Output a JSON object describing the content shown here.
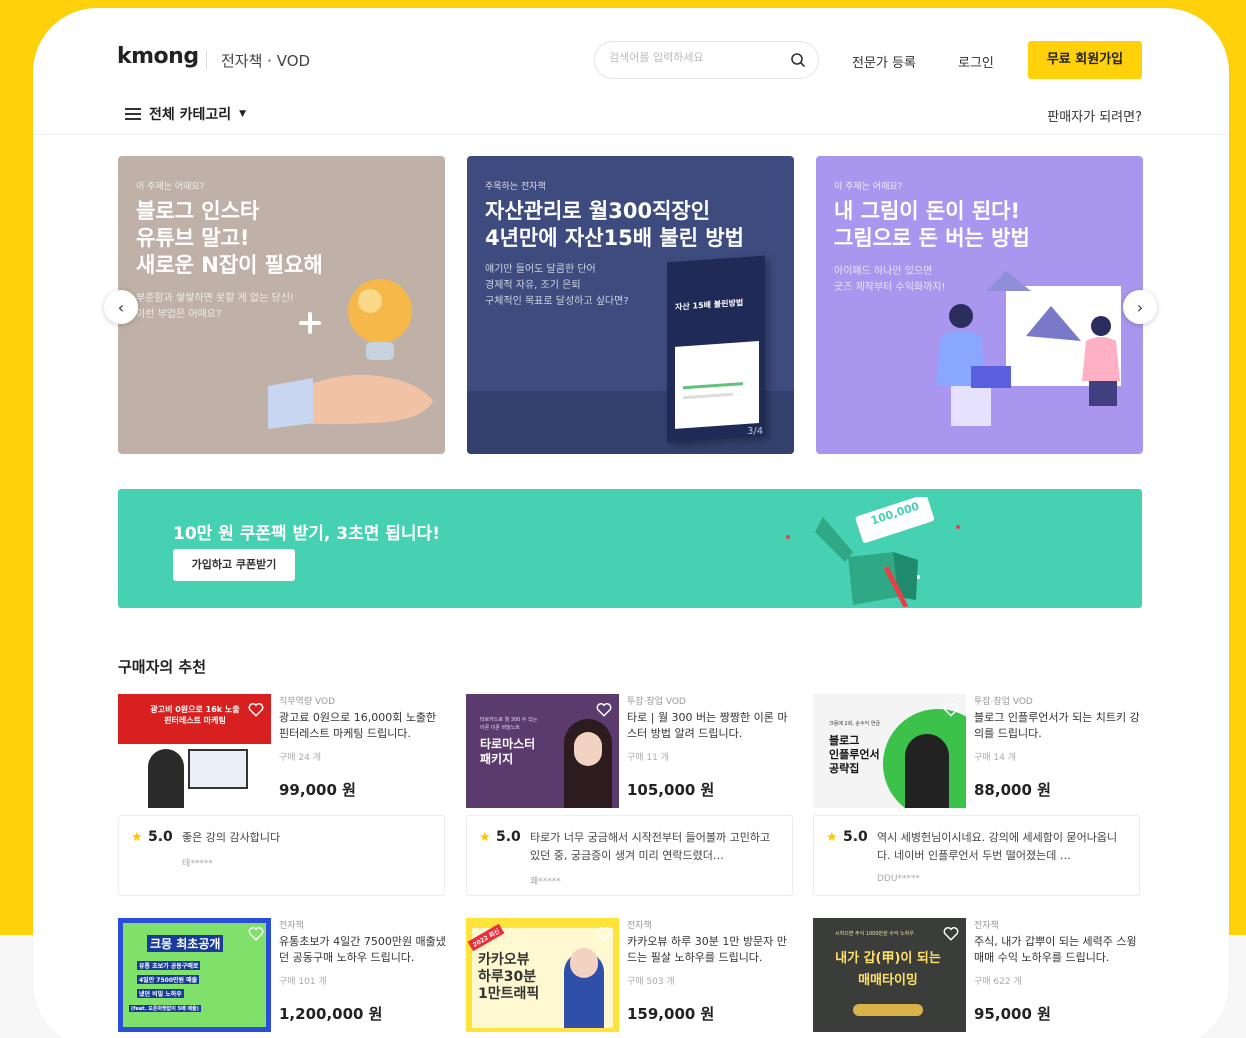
{
  "header": {
    "logo": "kmong",
    "section": "전자책 · VOD",
    "search_placeholder": "검색어를 입력하세요",
    "expert_register": "전문가 등록",
    "login": "로그인",
    "signup": "무료 회원가입",
    "all_categories": "전체 카테고리",
    "become_seller": "판매자가 되려면?"
  },
  "carousel": {
    "counter": "3/4",
    "slides": [
      {
        "kicker": "이 주제는 어때요?",
        "title": "블로그 인스타\n유튜브 말고!\n새로운 N잡이 필요해",
        "desc": "부준함과 쌓쌓하면 못할 게 없는 당신!\n이런 부업은 어때요?",
        "bg": "#bfb1a7"
      },
      {
        "kicker": "주목하는 전자책",
        "title": "자산관리로 월300직장인\n4년만에 자산15배 불린 방법",
        "desc": "얘기만 들어도 달콤한 단어\n경제적 자유, 조기 은퇴\n구체적인 목표로 달성하고 싶다면?",
        "book_title": "자산 15배 불린방법",
        "bg": "#3d4b7e"
      },
      {
        "kicker": "이 주제는 어때요?",
        "title": "내 그림이 돈이 된다!\n그림으로 돈 버는 방법",
        "desc": "아이패드 하나만 있으면\n굿즈 제작부터 수익화까지!",
        "bg": "#a996ee"
      }
    ]
  },
  "promo": {
    "title": "10만 원 쿠폰팩 받기, 3초면 됩니다!",
    "button": "가입하고 쿠폰받기",
    "coupon_label": "100,000",
    "bg": "#46d2b2"
  },
  "recommend": {
    "title": "구매자의 추천",
    "products": [
      {
        "category": "직무역량 VOD",
        "title": "광고료 0원으로 16,000회 노출한 핀터레스트 마케팅 드립니다.",
        "sold": "구매 24 개",
        "price": "99,000 원",
        "thumb_text": "광고비 0원으로 16k 노출\n핀터레스트 마케팅"
      },
      {
        "category": "투잡·창업 VOD",
        "title": "타로 | 월 300 버는 짱짱한 이론 마스터 방법 알려 드립니다.",
        "sold": "구매 11 개",
        "price": "105,000 원",
        "thumb_text": "타로마스터\n패키지",
        "thumb_small": "타로카드로 월 300 수 있는\n이론 이론 비밀노트"
      },
      {
        "category": "투잡·창업 VOD",
        "title": "블로그 인플루언서가 되는 치트키 강의를 드립니다.",
        "sold": "구매 14 개",
        "price": "88,000 원",
        "thumb_text": "블로그\n인플루언서\n공략집",
        "thumb_small": "크몽에 2회, 순수익 연금"
      },
      {
        "category": "전자책",
        "title": "유통초보가 4일간 7500만원 매출냈던 공동구매 노하우 드립니다.",
        "sold": "구매 101 개",
        "price": "1,200,000 원",
        "thumb_text": "크몽 최초공개",
        "thumb_lines": [
          "유통 초보가 공동구매로",
          "4일만 7500만원 매출",
          "냈던 비밀 노하우",
          "(feat. 오픈마켓없이 5배 매출)"
        ]
      },
      {
        "category": "전자책",
        "title": "카카오뷰 하루 30분 1만 방문자 만드는 필살 노하우를 드립니다.",
        "sold": "구매 503 개",
        "price": "159,000 원",
        "thumb_text": "카카오뷰\n하루30분\n1만트래픽",
        "thumb_badge": "2022 최신"
      },
      {
        "category": "전자책",
        "title": "주식, 내가 갑뿌이 되는 세력주 스윙매매 수익 노하우를 드립니다.",
        "sold": "구매 622 개",
        "price": "95,000 원",
        "thumb_text": "내가 갑(甲)이 되는\n매매타이밍",
        "thumb_small": "시히으면 주식 1000만원 수익 노하우"
      }
    ],
    "reviews": [
      {
        "score": "5.0",
        "text": "좋은 강의 감사합니다",
        "user": "테*****"
      },
      {
        "score": "5.0",
        "text": "타로가 너무 궁금해서 시작전부터 들어볼까 고민하고 있던 중, 궁금증이 생겨 미리 연락드렸더…",
        "user": "쾌*****"
      },
      {
        "score": "5.0",
        "text": "역시 세병헌님이시네요. 강의에 세세함이 묻어나옵니다. 네이버 인플루언서 두번 떨어졌는데 …",
        "user": "DDU*****"
      }
    ]
  },
  "colors": {
    "brand_yellow": "#ffd10b",
    "promo_green": "#46d2b2",
    "star": "#ffc400"
  }
}
